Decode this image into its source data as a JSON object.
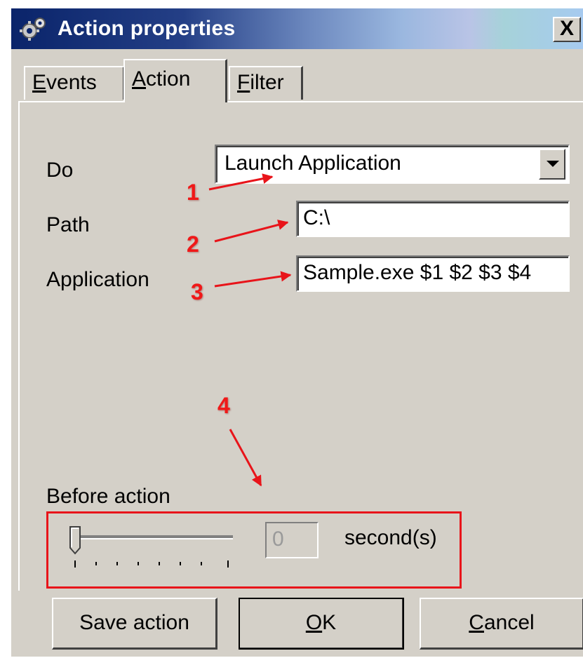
{
  "window": {
    "title": "Action properties",
    "close_label": "X"
  },
  "tabs": [
    {
      "label": "Events",
      "mnemonic": "E",
      "rest": "vents",
      "active": false
    },
    {
      "label": "Action",
      "mnemonic": "A",
      "rest": "ction",
      "active": true
    },
    {
      "label": "Filter",
      "mnemonic": "F",
      "rest": "ilter",
      "active": false
    }
  ],
  "form": {
    "do_label": "Do",
    "do_value": "Launch Application",
    "path_label": "Path",
    "path_value": "C:\\",
    "application_label": "Application",
    "application_value": "Sample.exe $1 $2 $3 $4"
  },
  "before_action": {
    "label": "Before action",
    "value": "0",
    "slider_position": 0,
    "unit": "second(s)"
  },
  "annotations": [
    "1",
    "2",
    "3",
    "4"
  ],
  "buttons": {
    "save": "Save action",
    "ok_mnemonic": "O",
    "ok_rest": "K",
    "cancel_mnemonic": "C",
    "cancel_rest": "ancel"
  },
  "colors": {
    "annotation_red": "#e8141a",
    "title_gradient_start": "#0a246a",
    "face": "#d4d0c8"
  }
}
